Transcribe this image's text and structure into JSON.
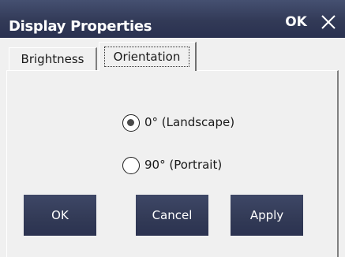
{
  "window": {
    "title": "Display Properties",
    "ok_label": "OK"
  },
  "tabs": [
    {
      "label": "Brightness",
      "active": false
    },
    {
      "label": "Orientation",
      "active": true
    }
  ],
  "orientation": {
    "options": [
      {
        "label": "0° (Landscape)",
        "selected": true
      },
      {
        "label": "90° (Portrait)",
        "selected": false
      }
    ]
  },
  "buttons": {
    "ok_label": "OK",
    "cancel_label": "Cancel",
    "apply_label": "Apply"
  },
  "icons": {
    "close": "close-icon"
  },
  "colors": {
    "titlebar": "#323a57",
    "button": "#363e5b",
    "background": "#f0f0f0"
  }
}
